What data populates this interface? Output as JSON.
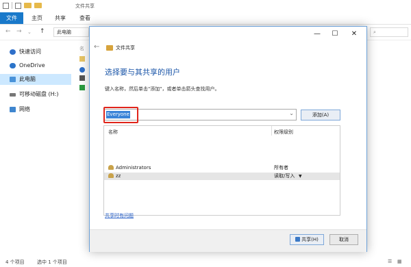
{
  "window": {
    "title": "文件共享",
    "ribbon_tabs": [
      "文件",
      "主页",
      "共享",
      "查看"
    ],
    "address": "此电脑",
    "search_placeholder": "",
    "content_peek": "名"
  },
  "sidebar": {
    "items": [
      {
        "label": "快速访问",
        "icon": "star-icon"
      },
      {
        "label": "OneDrive",
        "icon": "cloud-icon"
      },
      {
        "label": "此电脑",
        "icon": "pc-icon"
      },
      {
        "label": "可移动磁盘 (H:)",
        "icon": "drive-icon"
      },
      {
        "label": "网络",
        "icon": "network-icon"
      }
    ]
  },
  "status": {
    "count": "4 个项目",
    "selected": "选中 1 个项目"
  },
  "dialog": {
    "header_title": "文件共享",
    "heading": "选择要与其共享的用户",
    "instructions": "键入名称，然后单击\"添加\"，或者单击箭头查找用户。",
    "combo_value": "Everyone",
    "add_button": "添加(A)",
    "columns": {
      "name": "名称",
      "permission": "权限级别"
    },
    "rows": [
      {
        "name": "Administrators",
        "permission": "所有者"
      },
      {
        "name": "zz",
        "permission": "读取/写入",
        "dropdown": "▼"
      }
    ],
    "help_link": "共享时有问题",
    "share_button": "共享(H)",
    "cancel_button": "取消"
  }
}
